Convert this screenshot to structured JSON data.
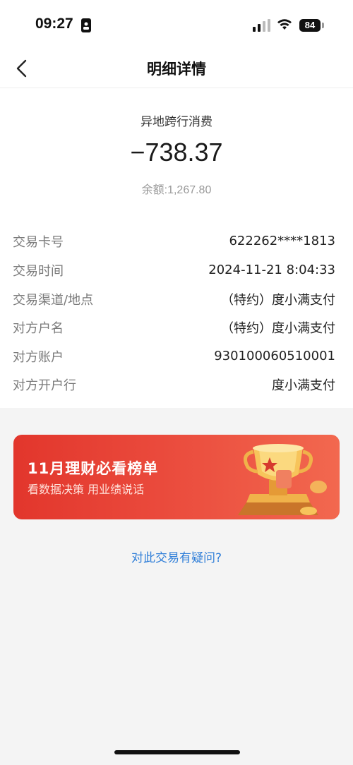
{
  "status_bar": {
    "time": "09:27",
    "battery": "84"
  },
  "nav": {
    "title": "明细详情",
    "back_icon": "chevron-left-icon"
  },
  "summary": {
    "type": "异地跨行消费",
    "amount": "−738.37",
    "balance": "余额:1,267.80"
  },
  "details": [
    {
      "label": "交易卡号",
      "value": "622262****1813"
    },
    {
      "label": "交易时间",
      "value": "2024-11-21 8:04:33"
    },
    {
      "label": "交易渠道/地点",
      "value": "（特约）度小满支付"
    },
    {
      "label": "对方户名",
      "value": "（特约）度小满支付"
    },
    {
      "label": "对方账户",
      "value": "930100060510001"
    },
    {
      "label": "对方开户行",
      "value": "度小满支付"
    }
  ],
  "banner": {
    "title": "11月理财必看榜单",
    "subtitle": "看数据决策 用业绩说话",
    "icon": "trophy-icon",
    "colors": {
      "start": "#e2362c",
      "end": "#f2684f"
    }
  },
  "question_link": "对此交易有疑问?",
  "colors": {
    "link": "#2f7ed8",
    "muted": "#999999",
    "background": "#f4f4f4"
  }
}
